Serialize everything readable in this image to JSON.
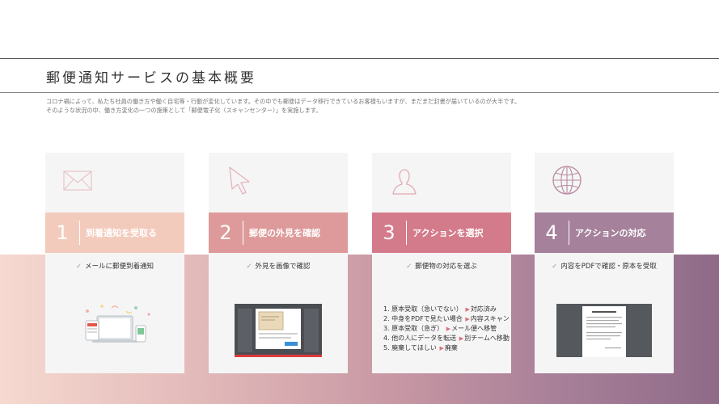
{
  "page": {
    "title": "郵便通知サービスの基本概要",
    "intro_lines": [
      "コロナ禍によって、私たち社員の働き方や働く自宅等・行動が変化しています。その中でも郵便はデータ移行できているお客様もいますが、まだまだ封書が届いているのが大半です。",
      "そのような状況の中、働き方変化の一つの施策として「郵便電子化（スキャンセンター）」を実施します。"
    ]
  },
  "colors": {
    "step1": "#f3cbbd",
    "step2": "#de9a9a",
    "step3": "#d47b8b",
    "step4": "#a5819b",
    "icon_stroke": "#d3a3ac"
  },
  "cards": [
    {
      "number": "1",
      "label": "到着通知を受取る",
      "icon": "envelope-icon",
      "check": "メールに郵便到着通知"
    },
    {
      "number": "2",
      "label": "郵便の外見を確認",
      "icon": "cursor-icon",
      "check": "外見を画像で確認"
    },
    {
      "number": "3",
      "label": "アクションを選択",
      "icon": "person-icon",
      "check": "郵便物の対応を選ぶ",
      "steps": [
        {
          "text": "1. 原本受取（急いでない）",
          "target": "対応済み"
        },
        {
          "text": "2. 中身をPDFで見たい場合",
          "target": "内容スキャン"
        },
        {
          "text": "3. 原本受取（急ぎ）",
          "target": "メール便へ移管"
        },
        {
          "text": "4. 他の人にデータを転送",
          "target": "別チームへ移動"
        },
        {
          "text": "5. 廃棄してほしい",
          "target": "廃棄"
        }
      ]
    },
    {
      "number": "4",
      "label": "アクションの対応",
      "icon": "globe-icon",
      "check": "内容をPDFで確認・原本を受取"
    }
  ]
}
